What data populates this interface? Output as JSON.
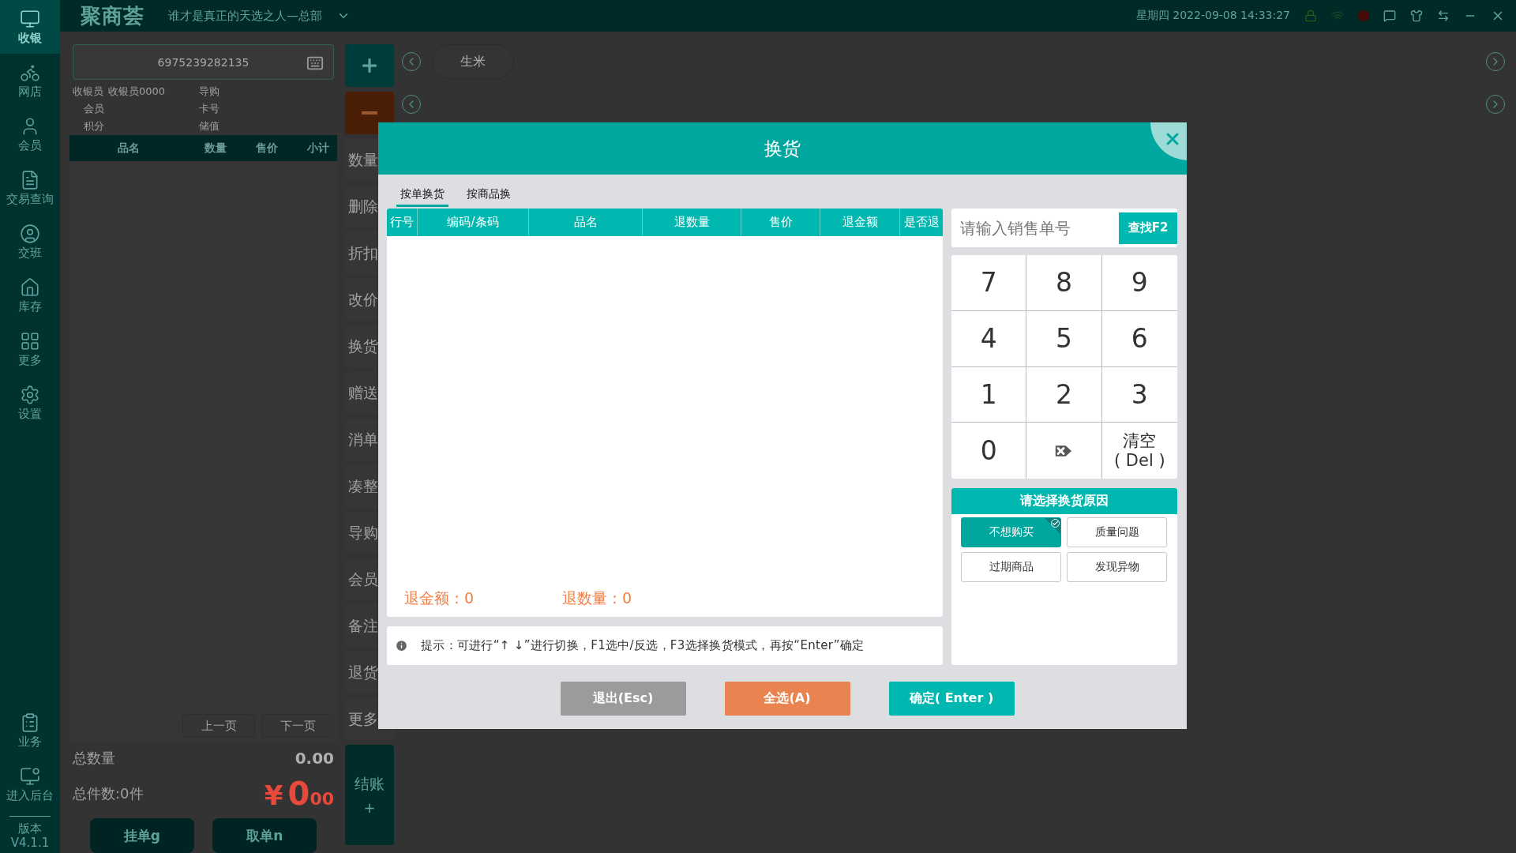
{
  "top_bar": {
    "logo": "聚商荟",
    "store": "谁才是真正的天选之人—总部",
    "datetime": "星期四 2022-09-08 14:33:27"
  },
  "sidebar": {
    "items": [
      {
        "label": "收银",
        "selected": true
      },
      {
        "label": "网店",
        "selected": false
      },
      {
        "label": "会员",
        "selected": false
      },
      {
        "label": "交易查询",
        "selected": false
      },
      {
        "label": "交班",
        "selected": false
      },
      {
        "label": "库存",
        "selected": false
      },
      {
        "label": "更多",
        "selected": false
      },
      {
        "label": "设置",
        "selected": false
      }
    ],
    "bottom_items": [
      "业务",
      "进入后台"
    ],
    "version_label": "版本",
    "version": "V4.1.1"
  },
  "order_panel": {
    "barcode": "6975239282135",
    "info": [
      {
        "label": "收银员",
        "value": "收银员0000"
      },
      {
        "label": "导购"
      },
      {
        "label": "会员"
      },
      {
        "label": "卡号"
      },
      {
        "label": "积分"
      },
      {
        "label": "储值"
      }
    ],
    "columns": [
      "品名",
      "数量",
      "售价",
      "小计"
    ],
    "pager": [
      "上一页",
      "下一页"
    ],
    "total_qty_label": "总数量",
    "total_qty": "0.00",
    "count": "总件数:0件",
    "currency": "¥",
    "amount_int": "0",
    "amount_dec": "00",
    "buttons": [
      "挂单g",
      "取单n"
    ]
  },
  "actions": {
    "items": [
      "数量",
      "删除",
      "折扣",
      "改价",
      "换货",
      "赠送",
      "消单",
      "凑整",
      "导购",
      "会员",
      "备注",
      "退货",
      "更多"
    ],
    "checkout": "结账",
    "checkout_sub": "+"
  },
  "categories": [
    {
      "label": "生米",
      "selected": false
    }
  ],
  "modal": {
    "title": "换货",
    "tabs": [
      {
        "label": "按单换货",
        "selected": true
      },
      {
        "label": "按商品换",
        "selected": false
      }
    ],
    "columns": [
      "行号",
      "编码/条码",
      "品名",
      "退数量",
      "售价",
      "退金额",
      "是否退"
    ],
    "summary": [
      {
        "label": "退金额：",
        "value": "0"
      },
      {
        "label": "退数量：",
        "value": "0"
      }
    ],
    "hint": "提示：可进行“↑ ↓”进行切换，F1选中/反选，F3选择换货模式，再按“Enter”确定",
    "search": {
      "placeholder": "请输入销售单号",
      "button": "查找F2"
    },
    "keypad": [
      {
        "kind": "digit",
        "label": "7"
      },
      {
        "kind": "digit",
        "label": "8"
      },
      {
        "kind": "digit",
        "label": "9"
      },
      {
        "kind": "digit",
        "label": "4"
      },
      {
        "kind": "digit",
        "label": "5"
      },
      {
        "kind": "digit",
        "label": "6"
      },
      {
        "kind": "digit",
        "label": "1"
      },
      {
        "kind": "digit",
        "label": "2"
      },
      {
        "kind": "digit",
        "label": "3"
      },
      {
        "kind": "digit",
        "label": "0"
      },
      {
        "kind": "backspace"
      },
      {
        "kind": "clear",
        "lines": [
          "清空",
          "( Del )"
        ]
      }
    ],
    "reason_title": "请选择换货原因",
    "reasons": [
      {
        "label": "不想购买",
        "selected": true
      },
      {
        "label": "质量问题",
        "selected": false
      },
      {
        "label": "过期商品",
        "selected": false
      },
      {
        "label": "发现异物",
        "selected": false
      }
    ],
    "buttons": [
      {
        "kind": "cancel",
        "label": "退出(Esc)"
      },
      {
        "kind": "select_all",
        "label": "全选(A)"
      },
      {
        "kind": "confirm",
        "label": "确定( Enter )"
      }
    ]
  }
}
